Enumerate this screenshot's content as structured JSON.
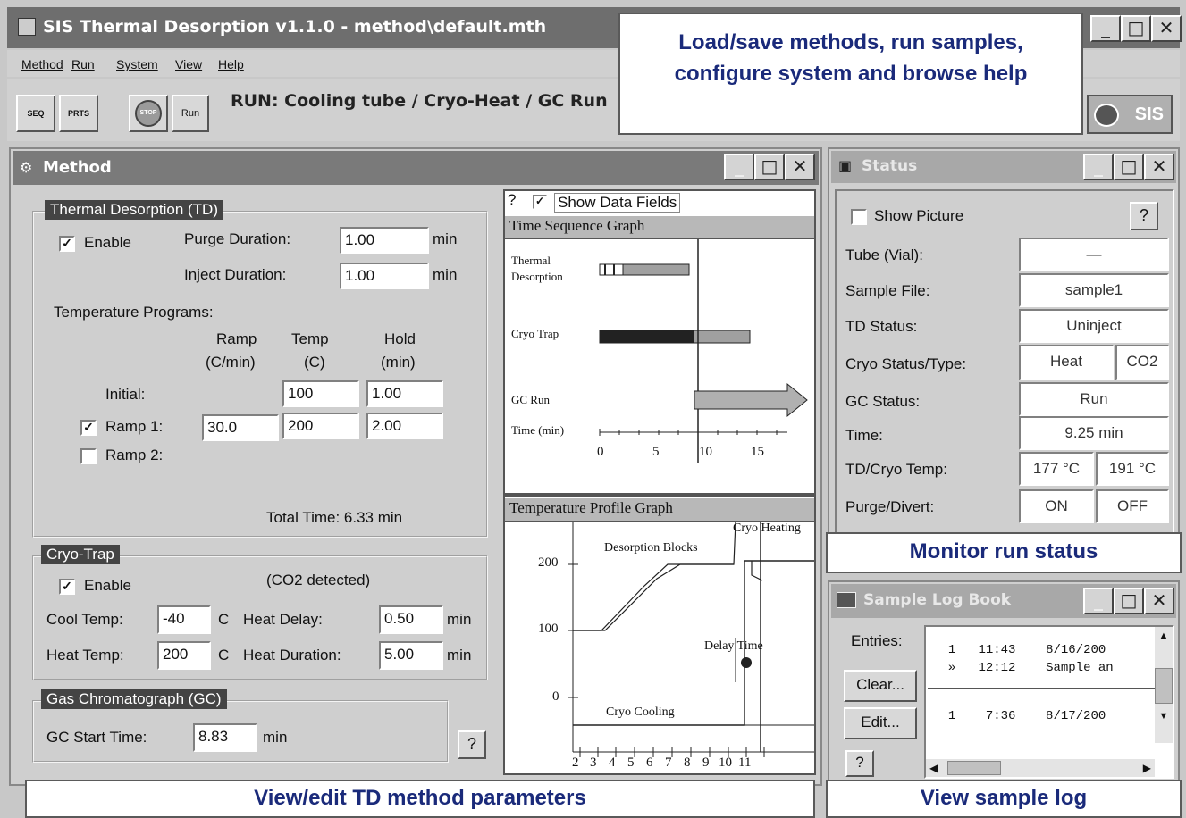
{
  "app": {
    "title": "SIS Thermal Desorption v1.1.0 - method\\default.mth",
    "menu": [
      "Method",
      "Run",
      "System",
      "View",
      "Help"
    ],
    "toolbar": {
      "buttons": [
        "SEQ",
        "PRTS",
        "STOP",
        "Run"
      ],
      "run_status": "RUN: Cooling tube / Cryo-Heat / GC Run",
      "logo": "SIS"
    }
  },
  "callouts": {
    "top": "Load/save methods, run samples, configure system and browse help",
    "status": "Monitor run status",
    "method": "View/edit TD method parameters",
    "log": "View sample log"
  },
  "method": {
    "title": "Method",
    "td": {
      "title": "Thermal Desorption (TD)",
      "enable_label": "Enable",
      "purge_label": "Purge Duration:",
      "purge_value": "1.00",
      "inject_label": "Inject Duration:",
      "inject_value": "1.00",
      "unit_min": "min",
      "temp_programs_label": "Temperature Programs:",
      "col_ramp": "Ramp",
      "col_ramp_unit": "(C/min)",
      "col_temp": "Temp",
      "col_temp_unit": "(C)",
      "col_hold": "Hold",
      "col_hold_unit": "(min)",
      "initial_label": "Initial:",
      "initial_temp": "100",
      "initial_hold": "1.00",
      "ramp1_label": "Ramp 1:",
      "ramp1_rate": "30.0",
      "ramp1_temp": "200",
      "ramp1_hold": "2.00",
      "ramp2_label": "Ramp 2:",
      "total_time": "Total Time: 6.33 min"
    },
    "cryo": {
      "title": "Cryo-Trap",
      "enable_label": "Enable",
      "detected": "(CO2 detected)",
      "cool_label": "Cool Temp:",
      "cool_value": "-40",
      "heat_label": "Heat Temp:",
      "heat_value": "200",
      "unit_c": "C",
      "heat_delay_label": "Heat Delay:",
      "heat_delay_value": "0.50",
      "heat_duration_label": "Heat Duration:",
      "heat_duration_value": "5.00",
      "unit_min": "min"
    },
    "gc": {
      "title": "Gas Chromatograph (GC)",
      "start_label": "GC Start Time:",
      "start_value": "8.83",
      "unit_min": "min",
      "help": "?"
    },
    "graphs": {
      "help": "?",
      "show_fields": "Show Data Fields",
      "time_seq_title": "Time Sequence Graph",
      "row_td_1": "Thermal",
      "row_td_2": "Desorption",
      "row_cryo": "Cryo Trap",
      "row_gc": "GC Run",
      "time_axis_label": "Time (min)",
      "time_ticks": [
        "0",
        "5",
        "10",
        "15"
      ],
      "temp_profile_title": "Temperature Profile Graph",
      "ann_desorption": "Desorption Blocks",
      "ann_cryo_heating": "Cryo Heating",
      "ann_delay": "Delay Time",
      "ann_cryo_cooling": "Cryo Cooling",
      "y_ticks": [
        "200",
        "100",
        "0"
      ],
      "x_ticks": [
        "2",
        "3",
        "4",
        "5",
        "6",
        "7",
        "8",
        "9",
        "10",
        "11"
      ]
    }
  },
  "status": {
    "title": "Status",
    "show_picture": "Show Picture",
    "help": "?",
    "rows": [
      {
        "label": "Tube (Vial):",
        "values": [
          "—"
        ]
      },
      {
        "label": "Sample File:",
        "values": [
          "sample1"
        ]
      },
      {
        "label": "TD Status:",
        "values": [
          "Uninject"
        ]
      },
      {
        "label": "Cryo Status/Type:",
        "values": [
          "Heat",
          "CO2"
        ]
      },
      {
        "label": "GC Status:",
        "values": [
          "Run"
        ]
      },
      {
        "label": "Time:",
        "values": [
          "9.25 min"
        ]
      },
      {
        "label": "TD/Cryo Temp:",
        "values": [
          "177 °C",
          "191 °C"
        ]
      },
      {
        "label": "Purge/Divert:",
        "values": [
          "ON",
          "OFF"
        ]
      }
    ]
  },
  "log": {
    "title": "Sample Log Book",
    "entries_label": "Entries:",
    "clear": "Clear...",
    "edit": "Edit...",
    "help": "?",
    "lines": [
      {
        "num": "1",
        "time": "11:43",
        "info": "8/16/200"
      },
      {
        "num": "»",
        "time": "12:12",
        "info": "Sample an"
      },
      {
        "num": "1",
        "time": "7:36",
        "info": "8/17/200"
      }
    ]
  },
  "colors": {
    "titlebar": "#7a7a7a",
    "callout_text": "#1a2a7a",
    "group_title_bg": "#444444"
  }
}
